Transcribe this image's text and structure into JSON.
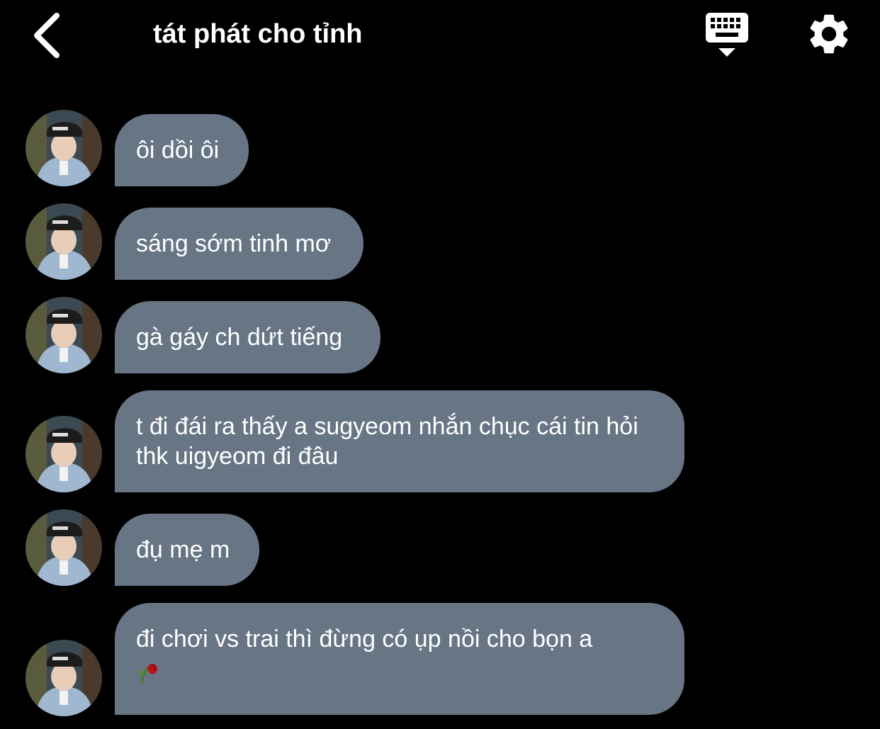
{
  "header": {
    "title": "tát phát cho tỉnh",
    "back_icon": "chevron-left-icon",
    "keyboard_icon": "keyboard-hide-icon",
    "settings_icon": "gear-icon"
  },
  "messages": [
    {
      "text": "ôi dồi ôi"
    },
    {
      "text": "sáng sớm tinh mơ"
    },
    {
      "text": "gà gáy ch dứt tiếng"
    },
    {
      "text": "t đi đái ra thấy a sugyeom nhắn chục cái tin hỏi thk uigyeom đi đâu"
    },
    {
      "text": "đụ mẹ m"
    },
    {
      "text": "đi chơi vs trai thì đừng có ụp nồi cho bọn a",
      "emoji": "wilted-rose-icon"
    }
  ],
  "colors": {
    "background": "#000000",
    "bubble": "#677585",
    "text": "#ffffff"
  }
}
